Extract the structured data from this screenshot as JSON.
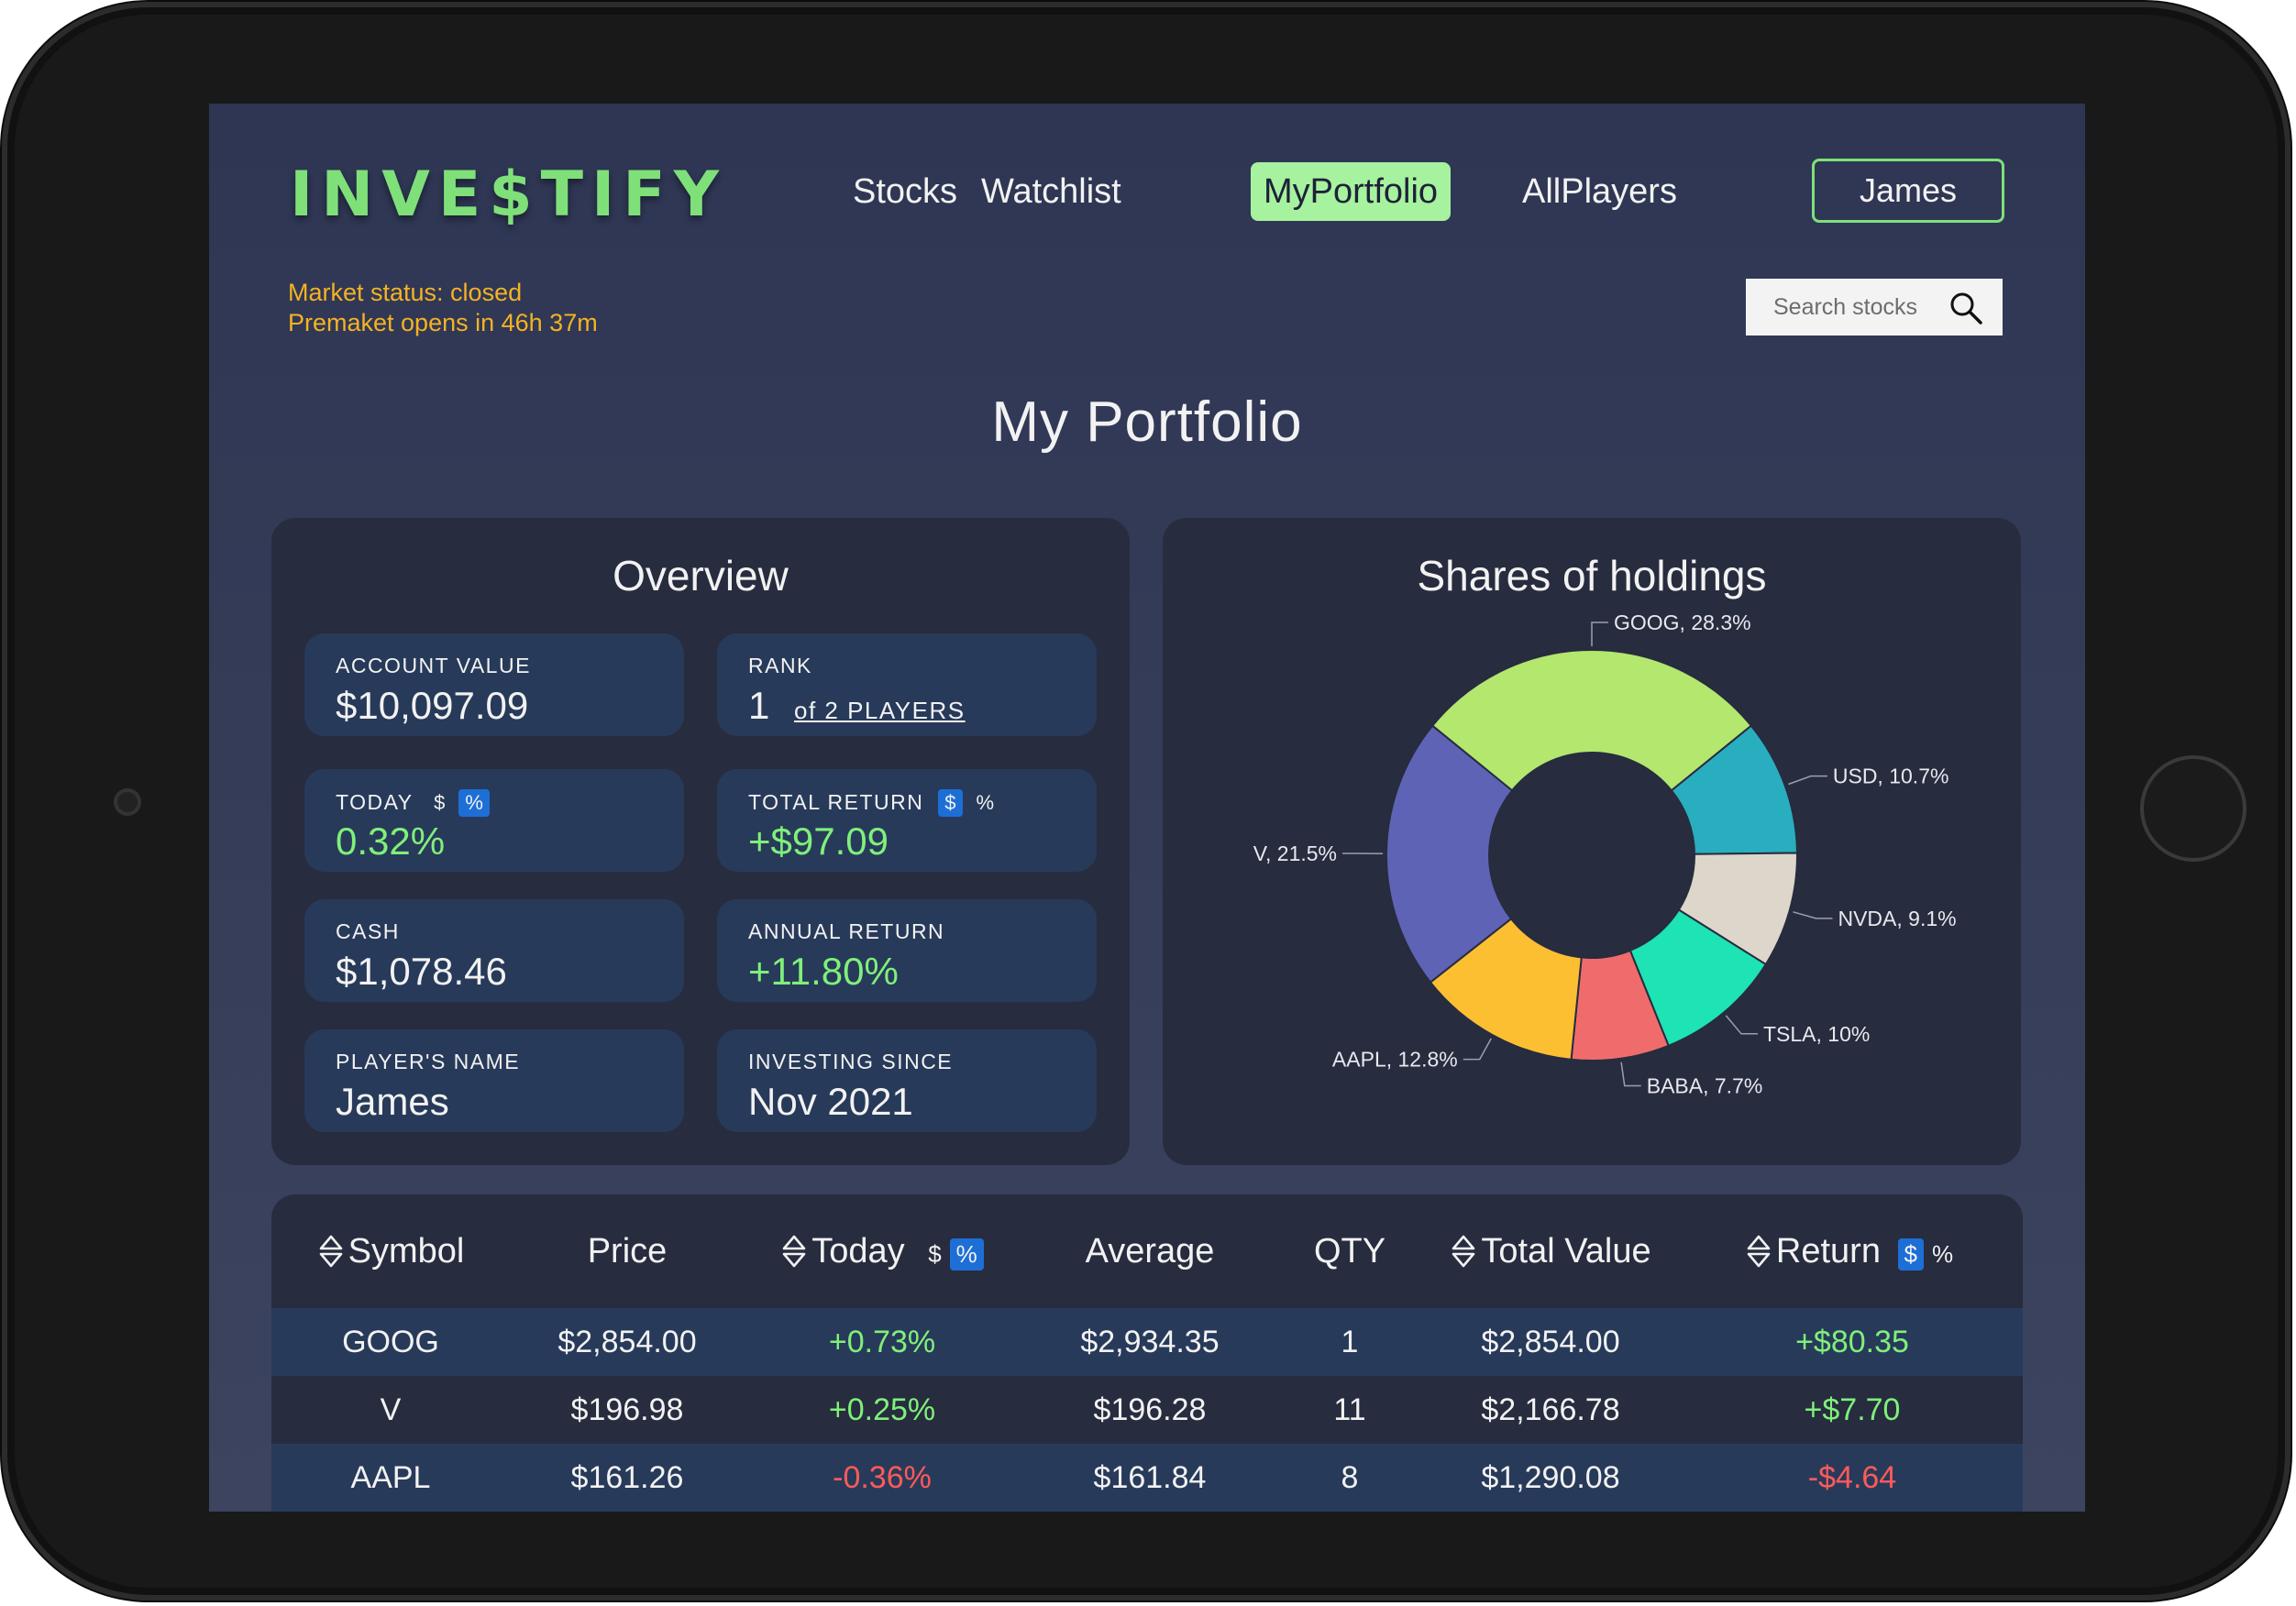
{
  "app": {
    "logo": "INVE$TIFY"
  },
  "nav": {
    "items": [
      {
        "label": "Stocks"
      },
      {
        "label": "Watchlist"
      },
      {
        "label": "MyPortfolio"
      },
      {
        "label": "AllPlayers"
      }
    ],
    "active": "MyPortfolio",
    "user_button": "James"
  },
  "market": {
    "status": "Market status: closed",
    "premarket": "Premaket opens in 46h 37m"
  },
  "search": {
    "placeholder": "Search stocks",
    "icon": "search-icon"
  },
  "page_title": "My Portfolio",
  "overview": {
    "title": "Overview",
    "account_value": {
      "label": "ACCOUNT VALUE",
      "value": "$10,097.09"
    },
    "rank": {
      "label": "RANK",
      "value": "1",
      "of_text": "of 2 PLAYERS"
    },
    "today": {
      "label": "TODAY",
      "toggle_dollar": "$",
      "toggle_percent": "%",
      "active": "%",
      "value": "0.32%"
    },
    "total_return": {
      "label": "TOTAL RETURN",
      "toggle_dollar": "$",
      "toggle_percent": "%",
      "active": "$",
      "value": "+$97.09"
    },
    "cash": {
      "label": "CASH",
      "value": "$1,078.46"
    },
    "annual_return": {
      "label": "ANNUAL RETURN",
      "value": "+11.80%"
    },
    "players_name": {
      "label": "PLAYER'S NAME",
      "value": "James"
    },
    "investing_since": {
      "label": "INVESTING SINCE",
      "value": "Nov 2021"
    }
  },
  "holdings_chart": {
    "title": "Shares of holdings",
    "chart_data": {
      "type": "pie",
      "donut": true,
      "slices": [
        {
          "label": "GOOG, 28.3%",
          "name": "GOOG",
          "value": 28.3,
          "color": "#b3e76e"
        },
        {
          "label": "USD, 10.7%",
          "name": "USD",
          "value": 10.7,
          "color": "#29aebf"
        },
        {
          "label": "NVDA, 9.1%",
          "name": "NVDA",
          "value": 9.1,
          "color": "#ddd6ca"
        },
        {
          "label": "TSLA, 10%",
          "name": "TSLA",
          "value": 10,
          "color": "#1ee3b4"
        },
        {
          "label": "BABA, 7.7%",
          "name": "BABA",
          "value": 7.7,
          "color": "#f06c6c"
        },
        {
          "label": "AAPL, 12.8%",
          "name": "AAPL",
          "value": 12.8,
          "color": "#fdbf32"
        },
        {
          "label": "V, 21.5%",
          "name": "V",
          "value": 21.5,
          "color": "#5f63b6"
        }
      ]
    }
  },
  "holdings_table": {
    "headers": {
      "symbol": "Symbol",
      "price": "Price",
      "today": "Today",
      "today_toggle_dollar": "$",
      "today_toggle_percent": "%",
      "average": "Average",
      "qty": "QTY",
      "total_value": "Total Value",
      "return": "Return",
      "return_toggle_dollar": "$",
      "return_toggle_percent": "%"
    },
    "rows": [
      {
        "symbol": "GOOG",
        "price": "$2,854.00",
        "today": "+0.73%",
        "average": "$2,934.35",
        "qty": "1",
        "total_value": "$2,854.00",
        "return": "+$80.35"
      },
      {
        "symbol": "V",
        "price": "$196.98",
        "today": "+0.25%",
        "average": "$196.28",
        "qty": "11",
        "total_value": "$2,166.78",
        "return": "+$7.70"
      },
      {
        "symbol": "AAPL",
        "price": "$161.26",
        "today": "-0.36%",
        "average": "$161.84",
        "qty": "8",
        "total_value": "$1,290.08",
        "return": "-$4.64"
      }
    ]
  }
}
